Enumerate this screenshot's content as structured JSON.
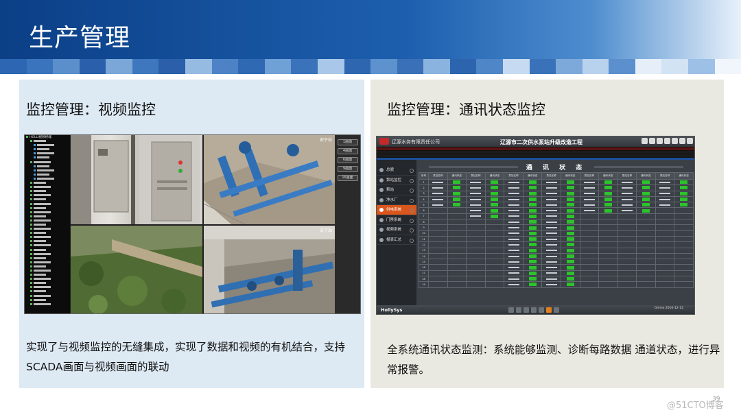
{
  "header": {
    "title": "生产管理"
  },
  "stripe_colors": [
    "#2d67b3",
    "#3a74bd",
    "#5a8fcc",
    "#2a60ab",
    "#7aa6d8",
    "#3f77bf",
    "#2b5fa9",
    "#96bbe2",
    "#4d83c6",
    "#2f69b3",
    "#6fa0d6",
    "#3b73bb",
    "#a9c8e9",
    "#2e66b0",
    "#5d92cf",
    "#3a70b8",
    "#8ab3df",
    "#2d64ae",
    "#4f86c8",
    "#c6dbf1",
    "#3a72ba",
    "#7da9da",
    "#b8d2ee",
    "#5b8fcd",
    "#e6eff9",
    "#d2e3f4",
    "#9cc0e6",
    "#f1f6fc"
  ],
  "left_panel": {
    "heading": "监控管理：视频监控",
    "caption": "实现了与视频监控的无缝集成，实现了数据和视频的有机结合，支持SCADA画面与视频画面的联动",
    "tree_root": "HOLLI视频终端",
    "camera_labels": [
      "安宁站",
      "安宁站"
    ],
    "side_buttons": [
      "1画面",
      "4画面",
      "6画面",
      "9画面",
      "16画面"
    ]
  },
  "right_panel": {
    "heading": "监控管理：通讯状态监控",
    "caption": "全系统通讯状态监测：系统能够监测、诊断每路数据 通道状态，进行异常报警。",
    "company": "辽源水务有限责任公司",
    "project_title": "辽源市二次供水泵站升级改造工程",
    "comm_title": "通 讯 状 态",
    "menu": [
      "总貌",
      "泵站监控",
      "泵站",
      "净水厂",
      "供电系统",
      "门禁系统",
      "视频系统",
      "报表汇总"
    ],
    "active_menu": "供电系统",
    "table_header": [
      "序号",
      "泵站名称",
      "通讯状态",
      "泵站名称",
      "通讯状态",
      "泵站名称",
      "通讯状态",
      "泵站名称",
      "通讯状态",
      "泵站名称",
      "通讯状态",
      "泵站名称",
      "通讯状态",
      "泵站名称",
      "通讯状态"
    ],
    "brand": "HollySys",
    "status_time": "Online  2016-12-12"
  },
  "page_number": "39",
  "watermark": "@51CTO博客"
}
